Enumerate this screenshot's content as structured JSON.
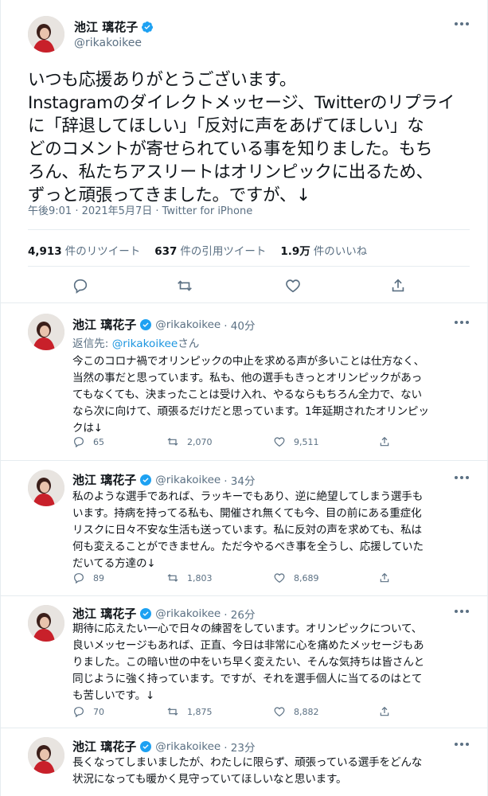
{
  "main_tweet": {
    "name": "池江 璃花子",
    "handle": "@rikakoikee",
    "text_lines": [
      "いつも応援ありがとうございます。",
      "Instagramのダイレクトメッセージ、Twitterのリプライ",
      "に「辞退してほしい」「反対に声をあげてほしい」な",
      "どのコメントが寄せられている事を知りました。もち",
      "ろん、私たちアスリートはオリンピックに出るため、",
      "ずっと頑張ってきました。ですが、↓"
    ],
    "meta": "午後9:01 · 2021年5月7日 · Twitter for iPhone",
    "retweets_count": "4,913",
    "retweets_label": "件のリツイート",
    "quotes_count": "637",
    "quotes_label": "件の引用ツイート",
    "likes_count": "1.9万",
    "likes_label": "件のいいね"
  },
  "replies": [
    {
      "name": "池江 璃花子",
      "handle": "@rikakoikee",
      "time": "· 40分",
      "replying_prefix": "返信先: ",
      "replying_handle": "@rikakoikee",
      "replying_suffix": "さん",
      "text_lines": [
        "今このコロナ禍でオリンピックの中止を求める声が多いことは仕方なく、",
        "当然の事だと思っています。私も、他の選手もきっとオリンピックがあっ",
        "てもなくても、決まったことは受け入れ、やるならもちろん全力で、ない",
        "なら次に向けて、頑張るだけだと思っています。1年延期されたオリンピッ",
        "クは↓"
      ],
      "reply_count": "65",
      "retweet_count": "2,070",
      "like_count": "9,511"
    },
    {
      "name": "池江 璃花子",
      "handle": "@rikakoikee",
      "time": "· 34分",
      "text_lines": [
        "私のような選手であれば、ラッキーでもあり、逆に絶望してしまう選手も",
        "います。持病を持ってる私も、開催され無くても今、目の前にある重症化",
        "リスクに日々不安な生活も送っています。私に反対の声を求めても、私は",
        "何も変えることができません。ただ今やるべき事を全うし、応援していた",
        "だいてる方達の↓"
      ],
      "reply_count": "89",
      "retweet_count": "1,803",
      "like_count": "8,689"
    },
    {
      "name": "池江 璃花子",
      "handle": "@rikakoikee",
      "time": "· 26分",
      "text_lines": [
        "期待に応えたい一心で日々の練習をしています。オリンピックについて、",
        "良いメッセージもあれば、正直、今日は非常に心を痛めたメッセージもあ",
        "りました。この暗い世の中をいち早く変えたい、そんな気持ちは皆さんと",
        "同じように強く持っています。ですが、それを選手個人に当てるのはとて",
        "も苦しいです。↓"
      ],
      "reply_count": "70",
      "retweet_count": "1,875",
      "like_count": "8,882"
    },
    {
      "name": "池江 璃花子",
      "handle": "@rikakoikee",
      "time": "· 23分",
      "text_lines": [
        "長くなってしまいましたが、わたしに限らず、頑張っている選手をどんな",
        "状況になっても暖かく見守っていてほしいなと思います。"
      ]
    }
  ],
  "colors": {
    "accent": "#1da1f2",
    "secondary_text": "#5b7083",
    "divider": "#e6ecf0"
  },
  "icons": [
    "verified-badge-icon",
    "more-icon",
    "reply-icon",
    "retweet-icon",
    "like-icon",
    "share-icon"
  ]
}
